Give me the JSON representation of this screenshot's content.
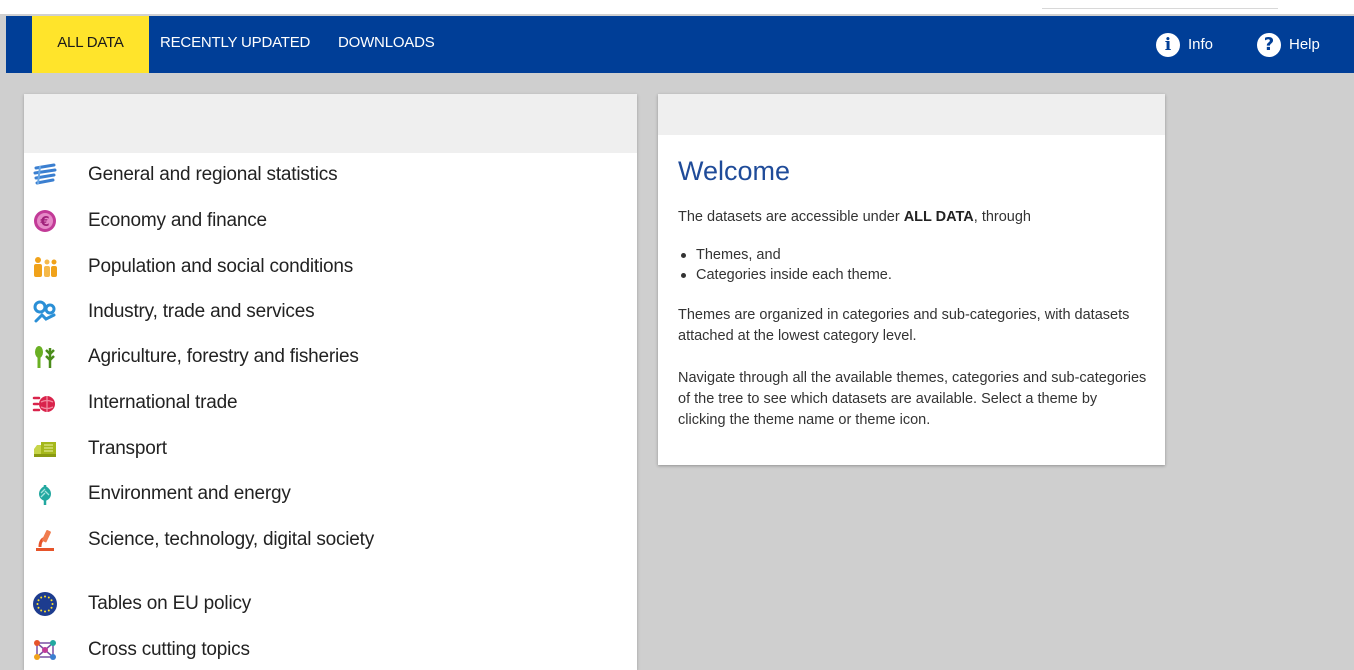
{
  "nav": {
    "tabs": [
      {
        "label": "ALL DATA",
        "active": true
      },
      {
        "label": "RECENTLY UPDATED",
        "active": false
      },
      {
        "label": "DOWNLOADS",
        "active": false
      }
    ],
    "info_label": "Info",
    "help_label": "Help"
  },
  "themes": [
    {
      "label": "General and regional statistics",
      "icon": "layers-icon",
      "color": "#3b7fd0"
    },
    {
      "label": "Economy and finance",
      "icon": "euro-coin-icon",
      "color": "#c23a97"
    },
    {
      "label": "Population and social conditions",
      "icon": "people-icon",
      "color": "#f0a21a"
    },
    {
      "label": "Industry, trade and services",
      "icon": "gears-people-icon",
      "color": "#2a8fd6"
    },
    {
      "label": "Agriculture, forestry and fisheries",
      "icon": "wheat-icon",
      "color": "#6ab023"
    },
    {
      "label": "International trade",
      "icon": "globe-arrows-icon",
      "color": "#d9234b"
    },
    {
      "label": "Transport",
      "icon": "truck-icon",
      "color": "#a5b81c"
    },
    {
      "label": "Environment and energy",
      "icon": "leaf-icon",
      "color": "#22a8a0"
    },
    {
      "label": "Science, technology, digital society",
      "icon": "microscope-icon",
      "color": "#e6542a"
    },
    {
      "label": "Tables on EU policy",
      "icon": "eu-flag-icon",
      "color": "#1d3c8f"
    },
    {
      "label": "Cross cutting topics",
      "icon": "network-icon",
      "color": "#7a4fa3"
    }
  ],
  "welcome": {
    "title": "Welcome",
    "intro_before": "The datasets are accessible under ",
    "intro_bold": "ALL DATA",
    "intro_after": ", through",
    "bullets": [
      "Themes, and",
      "Categories inside each theme."
    ],
    "para1": "Themes are organized in categories and sub-categories, with datasets attached at the lowest category level.",
    "para2": "Navigate through all the available themes, categories and sub-categories of the tree to see which datasets are available. Select a theme by clicking the theme name or theme icon."
  }
}
